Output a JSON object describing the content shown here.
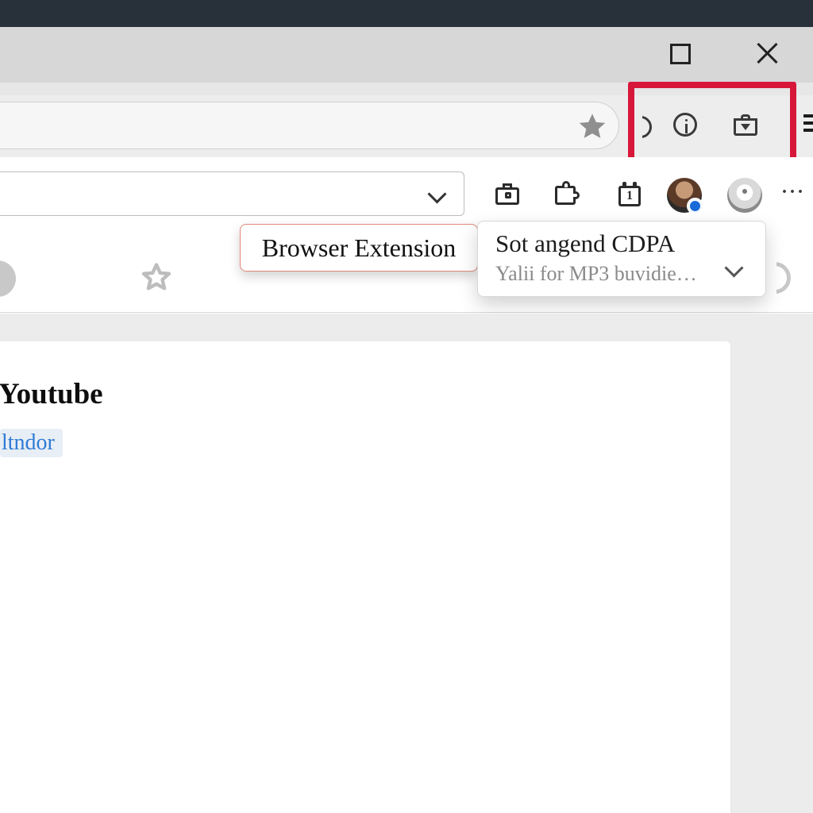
{
  "window": {
    "maximize_tooltip": "Maximize",
    "close_tooltip": "Close"
  },
  "address_bar": {
    "value": "",
    "star_tooltip": "Bookmark this page"
  },
  "highlight_icons": {
    "info_tooltip": "Info",
    "shop_tooltip": "Downloads"
  },
  "toolbar": {
    "dropdown_value": "",
    "camera_tooltip": "Capture",
    "puzzle_tooltip": "Extensions",
    "calendar_badge": "1",
    "overflow_label": "···"
  },
  "ext_pill_label": "Browser Extension",
  "tooltip": {
    "title": "Sot angend CDPA",
    "subtitle": "Yalii for MP3 buvidie…"
  },
  "content": {
    "heading_fragment": "Youtube",
    "tag_text": "ltndor"
  }
}
